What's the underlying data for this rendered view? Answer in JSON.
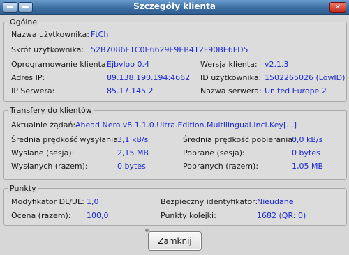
{
  "window": {
    "title": "Szczegóły klienta",
    "close_glyph": "✕"
  },
  "general": {
    "title": "Ogólne",
    "username_label": "Nazwa użytkownika:",
    "username": "FtCh",
    "hash_label": "Skrót użytkownika:",
    "hash": "52B7086F1C0E6629E9EB412F90BE6FD5",
    "software_label": "Oprogramowanie klienta:",
    "software": "Ejbvloo 0.4",
    "version_label": "Wersja klienta:",
    "version": "v2.1.3",
    "ip_label": "Adres IP:",
    "ip": "89.138.190.194:4662",
    "userid_label": "ID użytkownika:",
    "userid": "1502265026 (LowID)",
    "server_ip_label": "IP Serwera:",
    "server_ip": "85.17.145.2",
    "server_name_label": "Nazwa serwera:",
    "server_name": "United Europe 2"
  },
  "transfers": {
    "title": "Transfery do klientów",
    "current_label": "Aktualnie żądań:",
    "current": "Ahead.Nero.v8.1.1.0.Ultra.Edition.Multilingual.Incl.Key[...]",
    "avg_up_label": "Średnia prędkość wysyłania:",
    "avg_up": "3,1 kB/s",
    "avg_down_label": "Średnia prędkość pobierania:",
    "avg_down": "0,0 kB/s",
    "sent_session_label": "Wysłane (sesja):",
    "sent_session": "2,15 MB",
    "recv_session_label": "Pobrane (sesja):",
    "recv_session": "0 bytes",
    "sent_total_label": "Wysłanych (razem):",
    "sent_total": "0 bytes",
    "recv_total_label": "Pobranych (razem):",
    "recv_total": "1,05 MB"
  },
  "points": {
    "title": "Punkty",
    "modifier_label": "Modyfikator DL/UL:",
    "modifier": "1,0",
    "secure_id_label": "Bezpieczny identyfikator:",
    "secure_id": "Nieudane",
    "rating_label": "Ocena (razem):",
    "rating": "100,0",
    "queue_label": "Punkty kolejki:",
    "queue": "1682 (QR: 0)"
  },
  "buttons": {
    "close": "Zamknij"
  },
  "colors": {
    "value": "#1a2ad0",
    "titlebar": "#3d6fa3",
    "close": "#c32b1e"
  }
}
